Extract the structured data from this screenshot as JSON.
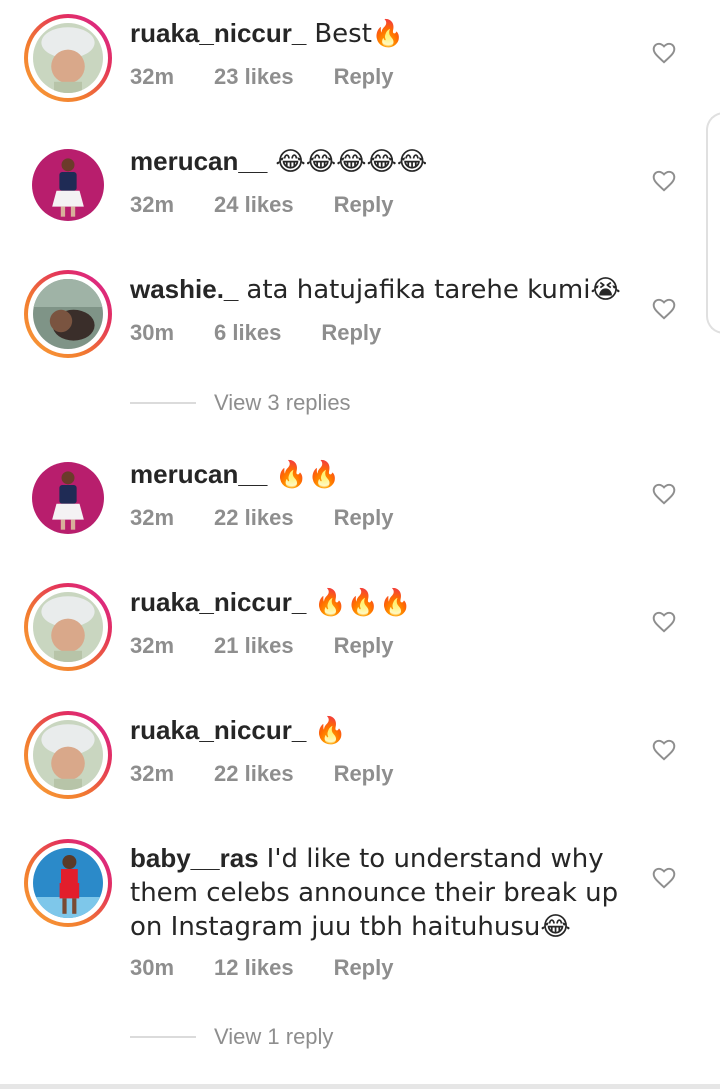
{
  "comments": [
    {
      "username": "ruaka_niccur_",
      "text": "Best🔥",
      "time": "32m",
      "likes": "23 likes",
      "reply": "Reply",
      "story_ring": true,
      "avatar_icon": "user-avatar-icon"
    },
    {
      "username": "merucan__",
      "text": "😂😂😂😂😂",
      "time": "32m",
      "likes": "24 likes",
      "reply": "Reply",
      "story_ring": false,
      "avatar_icon": "user-avatar-icon"
    },
    {
      "username": "washie._",
      "text": "ata hatujafika tarehe kumi😭",
      "time": "30m",
      "likes": "6 likes",
      "reply": "Reply",
      "story_ring": true,
      "avatar_icon": "user-avatar-icon",
      "view_replies": "View 3 replies"
    },
    {
      "username": "merucan__",
      "text": "🔥🔥",
      "time": "32m",
      "likes": "22 likes",
      "reply": "Reply",
      "story_ring": false,
      "avatar_icon": "user-avatar-icon"
    },
    {
      "username": "ruaka_niccur_",
      "text": "🔥🔥🔥",
      "time": "32m",
      "likes": "21 likes",
      "reply": "Reply",
      "story_ring": true,
      "avatar_icon": "user-avatar-icon"
    },
    {
      "username": "ruaka_niccur_",
      "text": "🔥",
      "time": "32m",
      "likes": "22 likes",
      "reply": "Reply",
      "story_ring": true,
      "avatar_icon": "user-avatar-icon"
    },
    {
      "username": "baby__ras",
      "text": "I'd like to understand why them celebs announce their break up on Instagram juu tbh haituhusu😂",
      "time": "30m",
      "likes": "12 likes",
      "reply": "Reply",
      "story_ring": true,
      "avatar_icon": "user-avatar-icon",
      "view_replies": "View 1 reply"
    }
  ],
  "icons": {
    "like": "heart-outline-icon"
  },
  "colors": {
    "text_primary": "#262626",
    "text_secondary": "#8e8e8e",
    "story_gradient_start": "#f9a13a",
    "story_gradient_end": "#d6249f"
  }
}
